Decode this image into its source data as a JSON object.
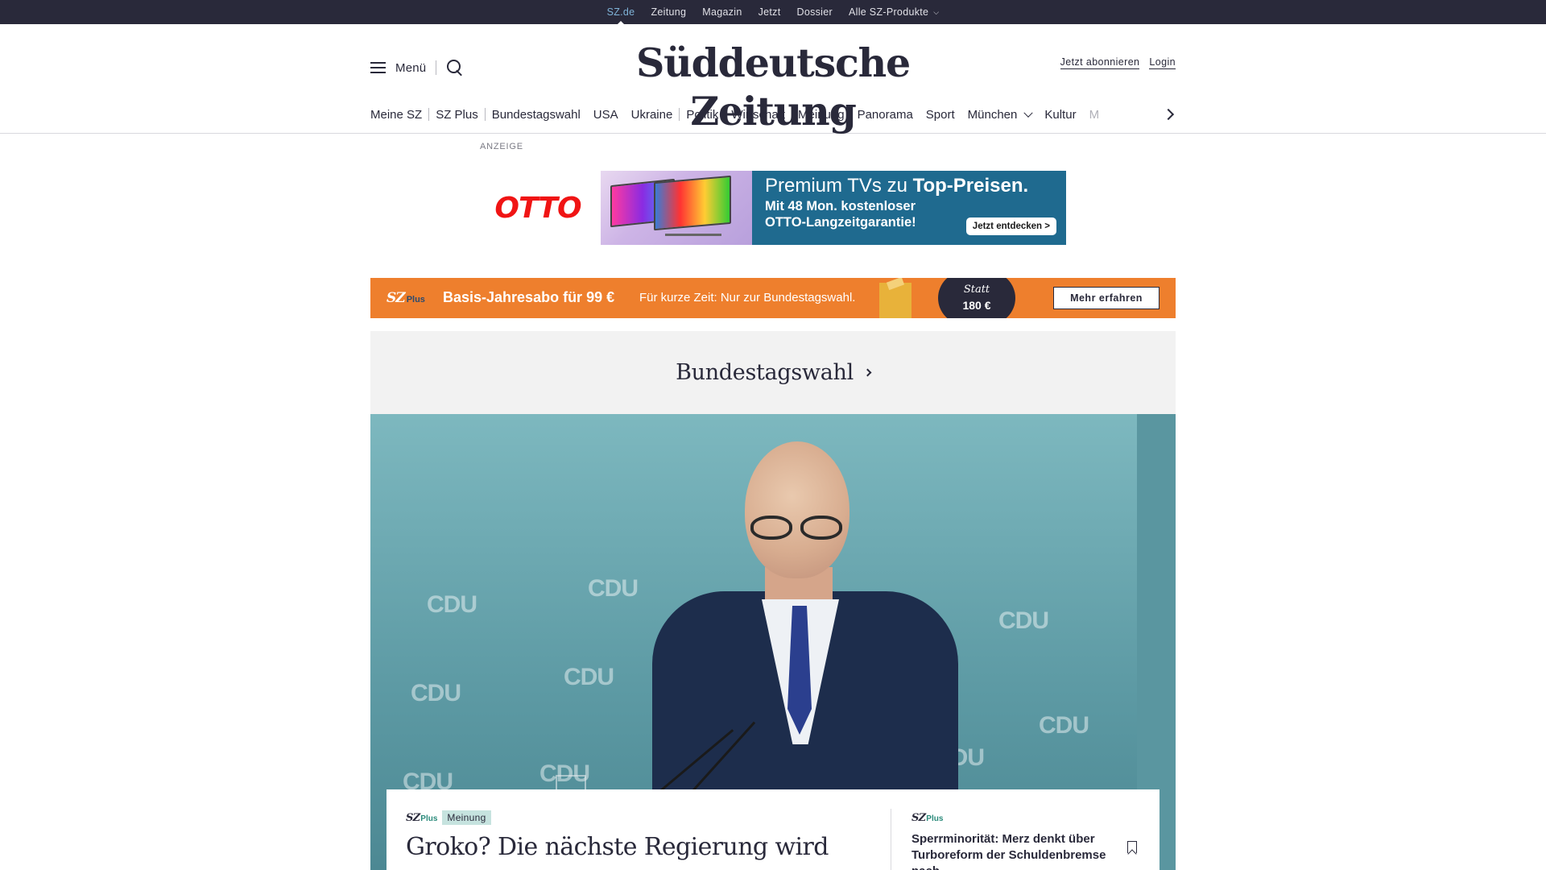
{
  "topbar": {
    "items": [
      "SZ.de",
      "Zeitung",
      "Magazin",
      "Jetzt",
      "Dossier",
      "Alle SZ-Produkte"
    ],
    "active": "SZ.de"
  },
  "header": {
    "menu_label": "Menü",
    "logo": "Süddeutsche Zeitung",
    "subscribe_label": "Jetzt abonnieren",
    "login_label": "Login"
  },
  "nav": {
    "items": [
      "Meine SZ",
      "SZ Plus",
      "Bundestagswahl",
      "USA",
      "Ukraine",
      "Politik",
      "Wirtschaft",
      "Meinung",
      "Panorama",
      "Sport",
      "München",
      "Kultur",
      "M"
    ]
  },
  "ad": {
    "label": "ANZEIGE",
    "brand": "OTTO",
    "title_regular": "Premium TVs zu ",
    "title_bold": "Top-Preisen.",
    "subtitle_line1": "Mit 48 Mon. kostenloser",
    "subtitle_line2": "OTTO-Langzeitgarantie!",
    "cta": "Jetzt entdecken >"
  },
  "promo": {
    "logo_sz": "SZ",
    "logo_plus": "Plus",
    "title": "Basis-Jahresabo für 99 €",
    "subtitle": "Für kurze Zeit: Nur zur Bundestagswahl.",
    "statt": "Statt",
    "old_price": "180 €",
    "button": "Mehr erfahren",
    "color": "#ee7f2d"
  },
  "section": {
    "title": "Bundestagswahl"
  },
  "hero": {
    "watermark": "CDU"
  },
  "article": {
    "sz": "SZ",
    "plus": "Plus",
    "tag": "Meinung",
    "headline": "Groko? Die nächste Regierung wird"
  },
  "side_article": {
    "sz": "SZ",
    "plus": "Plus",
    "headline": "Sperrminorität: Merz denkt über Turboreform der Schuldenbremse nach"
  },
  "colors": {
    "topbar": "#29293a",
    "accent_link": "#7fb3d8",
    "ad_blue": "#1f6a8f",
    "meinung_badge": "#c6e3df"
  }
}
